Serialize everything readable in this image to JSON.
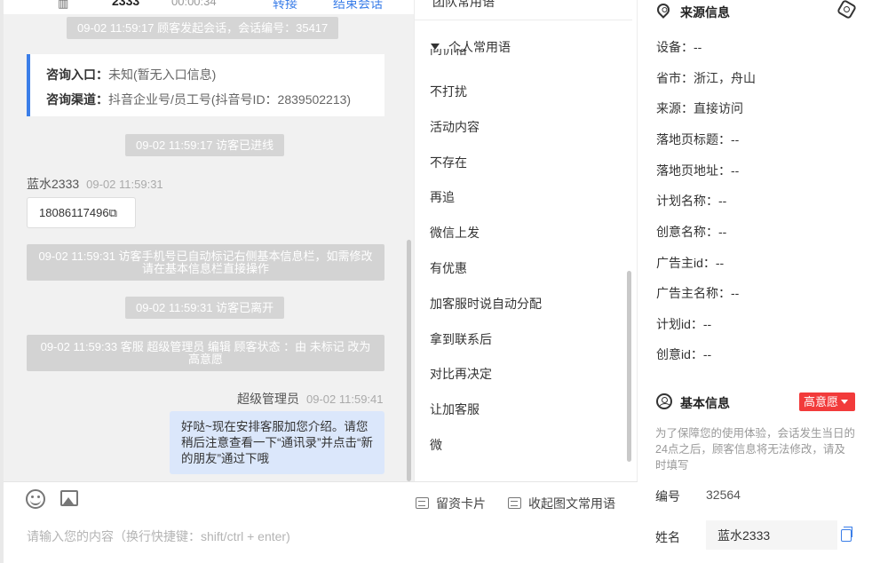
{
  "topbar": {
    "name": "2333",
    "time": "00:00:34",
    "transfer_label": "转接",
    "end_label": "结束会话",
    "icon": "table-icon"
  },
  "chat": {
    "sys_session_start": "09-02 11:59:17 顾客发起会话，会话编号：35417",
    "consult_entry_label": "咨询入口：",
    "consult_entry_value": "未知(暂无入口信息)",
    "consult_channel_label": "咨询渠道：",
    "consult_channel_value": "抖音企业号/员工号(抖音号ID：2839502213)",
    "sys_visitor_join": "09-02 11:59:17 访客已进线",
    "visitor_name": "蓝水2333",
    "visitor_time": "09-02 11:59:31",
    "phone_message": "18086117496",
    "sys_phone_tag": "09-02 11:59:31 访客手机号已自动标记右侧基本信息栏，如需修改请在基本信息栏直接操作",
    "sys_visitor_left": "09-02 11:59:31 访客已离开",
    "sys_status_change": "09-02 11:59:33 客服 超级管理员 编辑 顾客状态 ：由 未标记 改为 高意愿",
    "agent_name": "超级管理员",
    "agent_time": "09-02 11:59:41",
    "agent_message": "好哒~现在安排客服加您介绍。请您稍后注意查看一下“通讯录”并点击“新的朋友”通过下哦"
  },
  "input": {
    "emoji_icon": "emoji-icon",
    "image_icon": "image-icon",
    "card_button": "留资卡片",
    "collapse_button": "收起图文常用语",
    "placeholder": "请输入您的内容（换行快捷键：shift/ctrl + enter)"
  },
  "phrases": {
    "team_head": "团队常用语",
    "section_title": "个人常用语",
    "cut_item": "问价格",
    "items": [
      "不打扰",
      "活动内容",
      "不存在",
      "再追",
      "微信上发",
      "有优惠",
      "加客服时说自动分配",
      "拿到联系后",
      "对比再决定",
      "让加客服",
      "微"
    ]
  },
  "source_info": {
    "title": "来源信息",
    "rows": [
      "设备：--",
      "省市：浙江，舟山",
      "来源：直接访问",
      "落地页标题：--",
      "落地页地址：--",
      "计划名称：--",
      "创意名称：--",
      "广告主id：--",
      "广告主名称：--",
      "计划id：--",
      "创意id：--"
    ]
  },
  "basic_info": {
    "title": "基本信息",
    "intent_label": "高意愿",
    "notice": "为了保障您的使用体验，会话发生当日的24点之后，顾客信息将无法修改，请及时填写",
    "id_label": "编号",
    "id_value": "32564",
    "name_label": "姓名",
    "name_value": "蓝水2333"
  },
  "colors": {
    "accent": "#3b7ee8",
    "badge": "#f23b3b",
    "agent_bubble": "#dbe7fb",
    "system_pill": "#d5d5d5"
  }
}
